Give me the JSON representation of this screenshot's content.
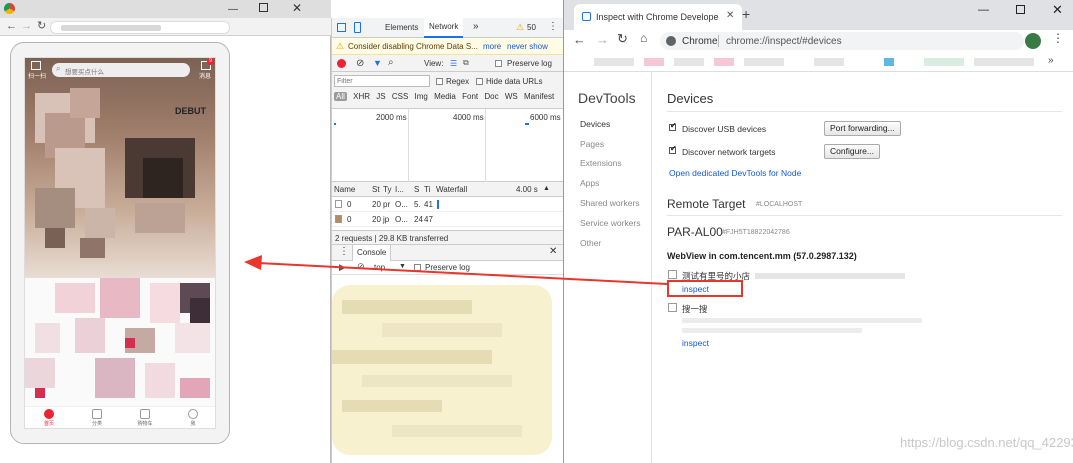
{
  "left_window": {
    "phone": {
      "scan_label": "扫一扫",
      "search_placeholder": "想要买点什么",
      "message_label": "消息",
      "message_badge": "9",
      "banner_text": "DEBUT",
      "tabs": [
        {
          "label": "首页",
          "icon": "home-icon"
        },
        {
          "label": "分类",
          "icon": "category-icon"
        },
        {
          "label": "购物车",
          "icon": "cart-icon"
        },
        {
          "label": "我",
          "icon": "user-icon"
        }
      ]
    },
    "devtools": {
      "tabs": [
        "Elements",
        "Network"
      ],
      "more": "»",
      "warning_count": "50",
      "warning_text": "Consider disabling Chrome Data S...",
      "warning_more": "more",
      "warning_never": "never show",
      "preserve_log": "Preserve log",
      "view_label": "View:",
      "filter_placeholder": "Filter",
      "regex": "Regex",
      "hide_data_urls": "Hide data URLs",
      "type_filters": [
        "All",
        "XHR",
        "JS",
        "CSS",
        "Img",
        "Media",
        "Font",
        "Doc",
        "WS",
        "Manifest"
      ],
      "timeline_ticks": [
        "2000 ms",
        "4000 ms",
        "6000 ms"
      ],
      "columns": [
        "Name",
        "St",
        "Ty",
        "I...",
        "S",
        "Ti",
        "Waterfall"
      ],
      "waterfall_scale": "4.00 s",
      "rows": [
        {
          "name": "0",
          "status": "20",
          "type": "pr",
          "initiator": "O...",
          "size": "5.",
          "time": "41"
        },
        {
          "name": "0",
          "status": "20",
          "type": "jp",
          "initiator": "O...",
          "size": "24",
          "time": "47"
        }
      ],
      "summary": "2 requests | 29.8 KB transferred",
      "console_tab": "Console",
      "console_context": "top",
      "console_preserve": "Preserve log"
    }
  },
  "right_window": {
    "tab_title": "Inspect with Chrome Develope",
    "omnibox": {
      "origin": "Chrome",
      "path": "chrome://inspect/#devices"
    },
    "sidebar": {
      "title": "DevTools",
      "items": [
        "Devices",
        "Pages",
        "Extensions",
        "Apps",
        "Shared workers",
        "Service workers",
        "Other"
      ],
      "active": "Devices"
    },
    "devices": {
      "heading": "Devices",
      "discover_usb": "Discover USB devices",
      "port_forwarding": "Port forwarding...",
      "discover_network": "Discover network targets",
      "configure": "Configure...",
      "open_node": "Open dedicated DevTools for Node",
      "remote_target": "Remote Target",
      "remote_target_host": "#LOCALHOST",
      "device_name": "PAR-AL00",
      "device_serial": "#FJH5T18822042786",
      "webview": "WebView in com.tencent.mm (57.0.2987.132)",
      "targets": [
        {
          "title": "测试有里号的小店",
          "action": "inspect"
        },
        {
          "title": "搜一搜",
          "action": "inspect"
        }
      ]
    }
  },
  "watermark": "https://blog.csdn.net/qq_42293487",
  "colors": {
    "annotation_red": "#e8362c",
    "link_blue": "#1558d6",
    "warn_bg": "#fffbe5"
  }
}
